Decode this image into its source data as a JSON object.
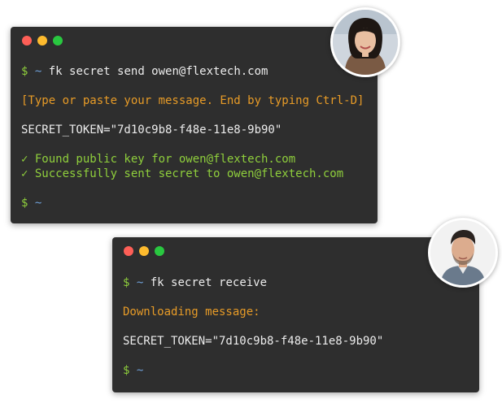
{
  "colors": {
    "close": "#fe5f57",
    "minimize": "#febb2e",
    "maximize": "#29c840",
    "terminal_bg": "#2e2e2e",
    "prompt": "#8fcf3c",
    "tilde": "#6fa0d8",
    "info": "#e79b27",
    "success": "#8fcf3c"
  },
  "sender_terminal": {
    "prompt_dollar": "$",
    "prompt_tilde": "~",
    "command": "fk secret send owen@flextech.com",
    "instruction": "[Type or paste your message. End by typing Ctrl-D]",
    "token_line": "SECRET_TOKEN=\"7d10c9b8-f48e-11e8-9b90\"",
    "success_1": "✓ Found public key for owen@flextech.com",
    "success_2": "✓ Successfully sent secret to owen@flextech.com",
    "end_prompt_dollar": "$",
    "end_prompt_tilde": "~"
  },
  "receiver_terminal": {
    "prompt_dollar": "$",
    "prompt_tilde": "~",
    "command": "fk secret receive",
    "status": "Downloading message:",
    "token_line": "SECRET_TOKEN=\"7d10c9b8-f48e-11e8-9b90\"",
    "end_prompt_dollar": "$",
    "end_prompt_tilde": "~"
  },
  "avatars": {
    "sender": "woman-avatar",
    "receiver": "man-avatar"
  }
}
